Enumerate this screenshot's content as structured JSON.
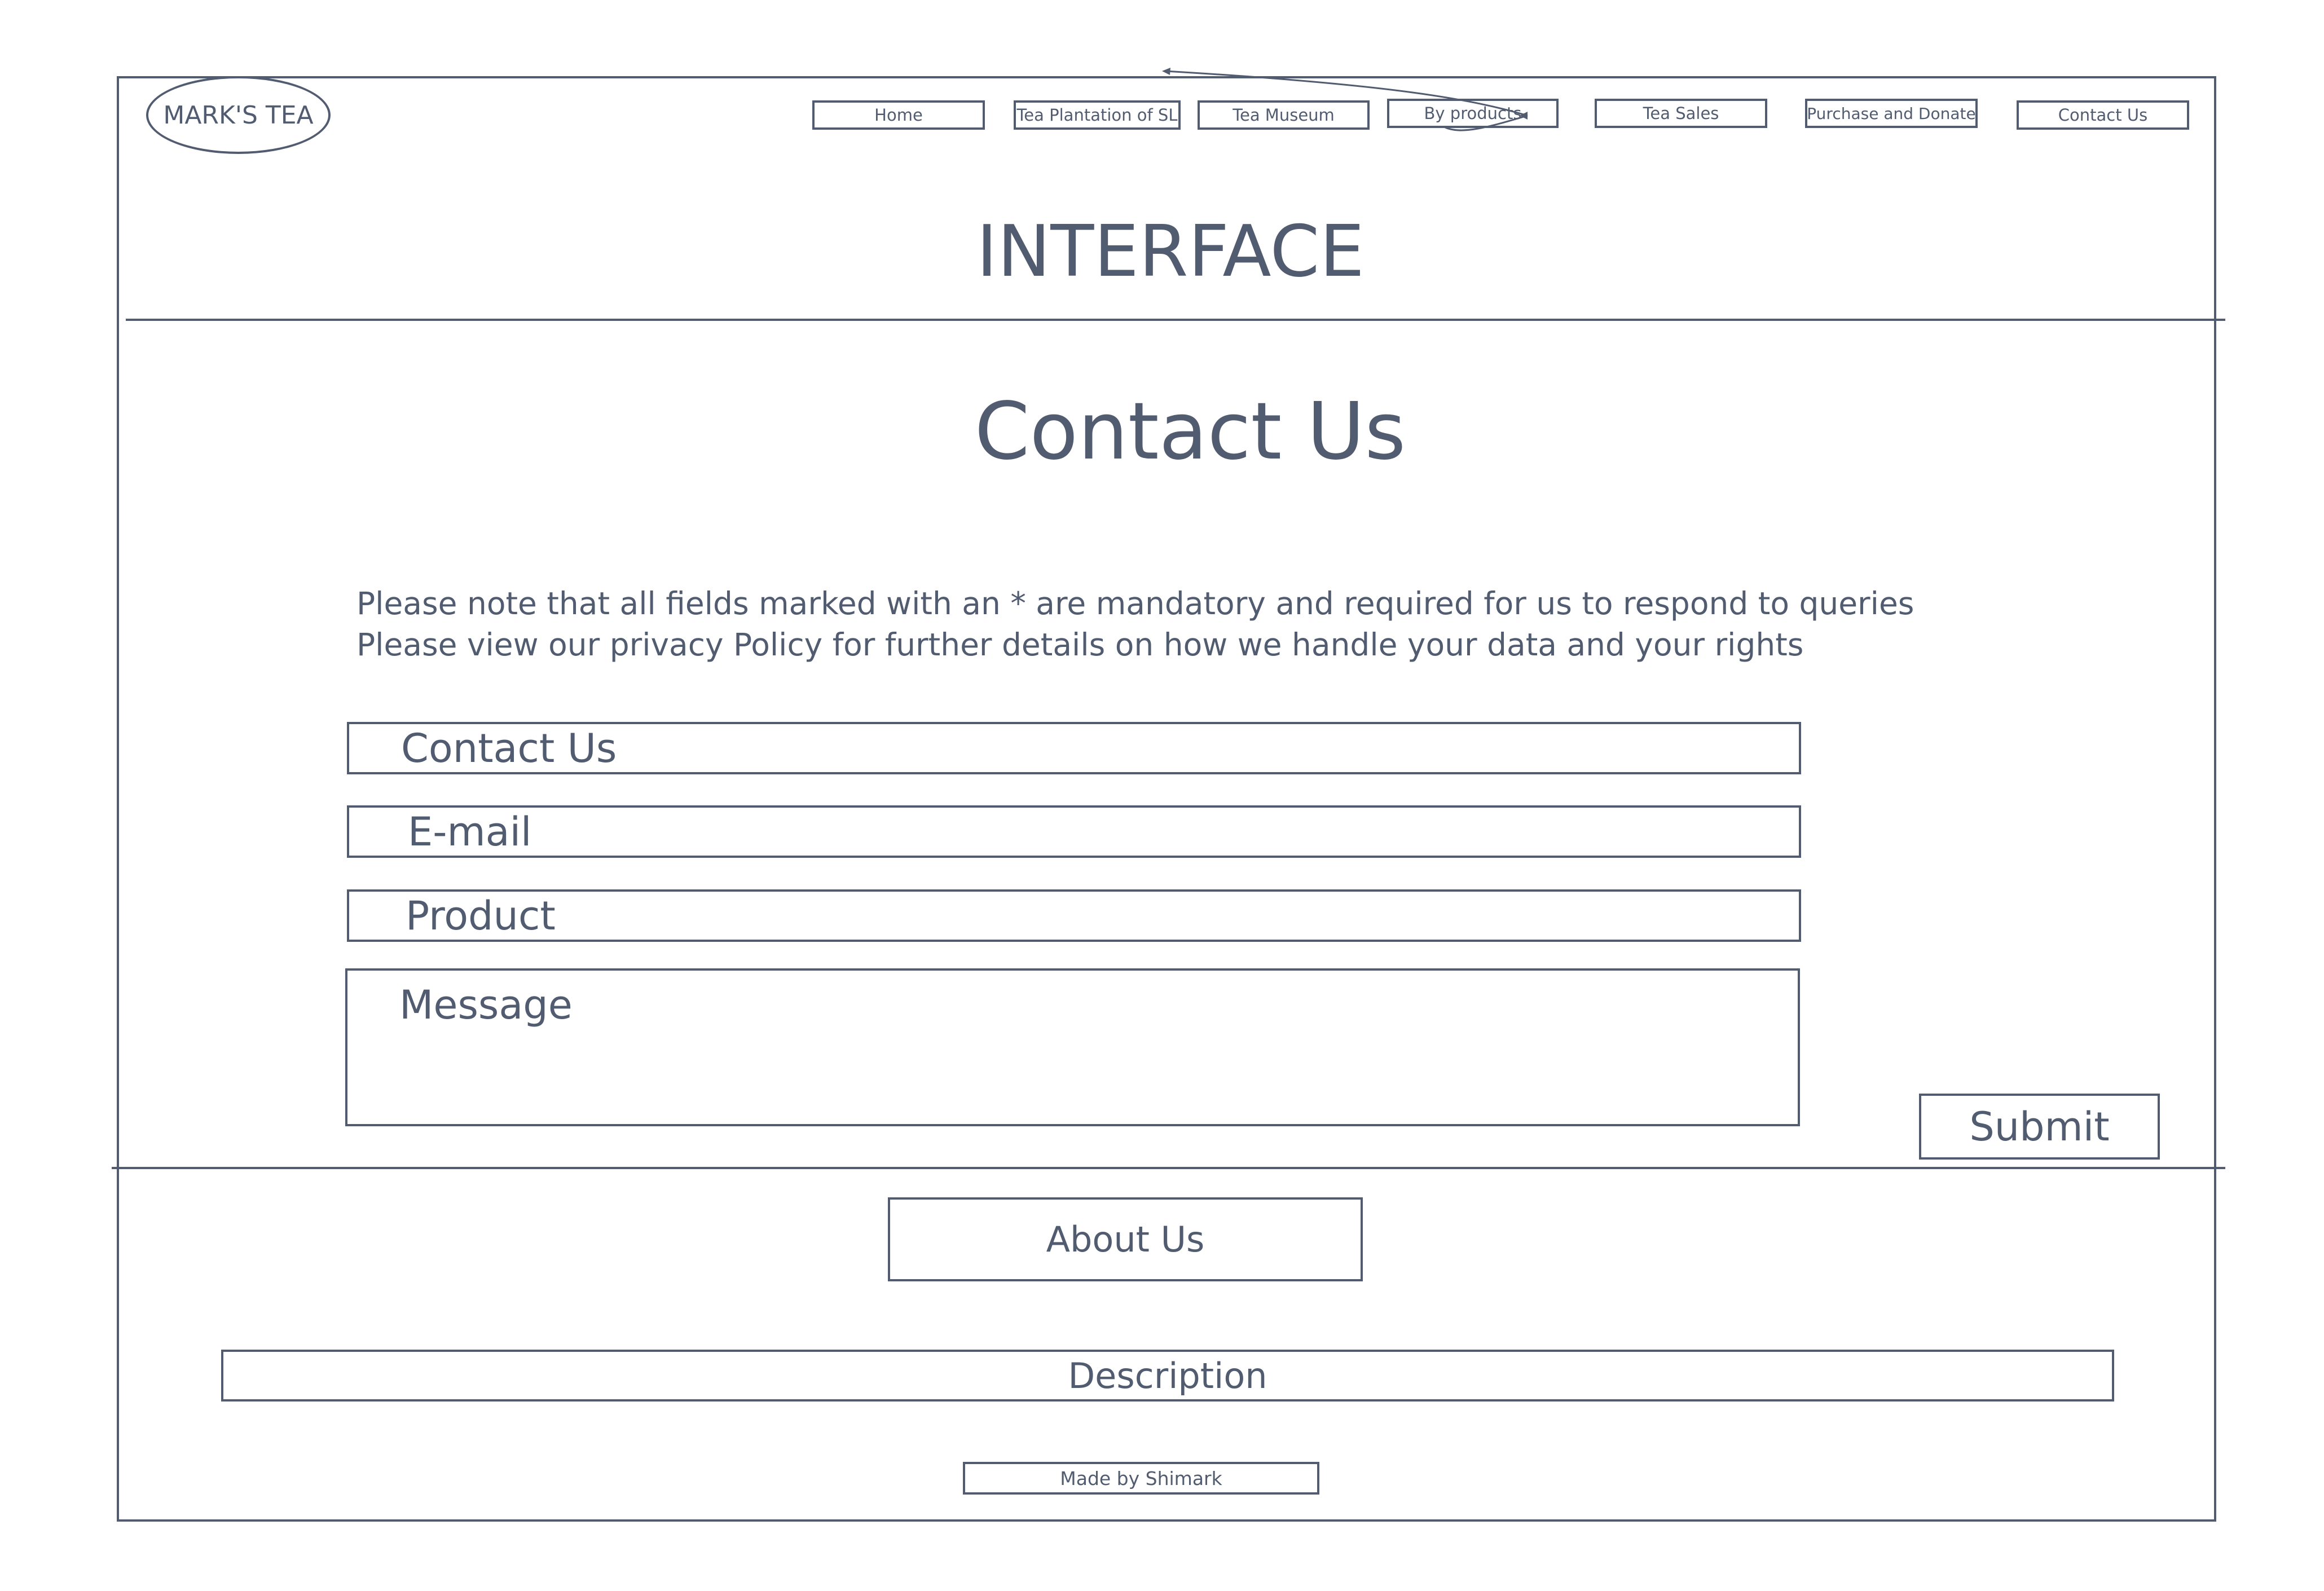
{
  "header": {
    "logo": "MARK'S TEA",
    "nav": [
      {
        "label": "Home"
      },
      {
        "label": "Tea Plantation of SL"
      },
      {
        "label": "Tea Museum"
      },
      {
        "label": "By products"
      },
      {
        "label": "Tea Sales"
      },
      {
        "label": "Purchase and Donate"
      },
      {
        "label": "Contact Us"
      }
    ],
    "banner": "INTERFACE"
  },
  "main": {
    "title": "Contact Us",
    "notes": [
      "Please note that all fields marked with an * are mandatory and required for us to respond to queries",
      "Please view our privacy Policy for further details on how we handle your data and your rights"
    ],
    "fields": {
      "contact": "Contact Us",
      "email": "E-mail",
      "product": "Product",
      "message": "Message"
    },
    "submit": "Submit"
  },
  "footer": {
    "about": "About Us",
    "description": "Description",
    "credit": "Made by Shimark"
  }
}
